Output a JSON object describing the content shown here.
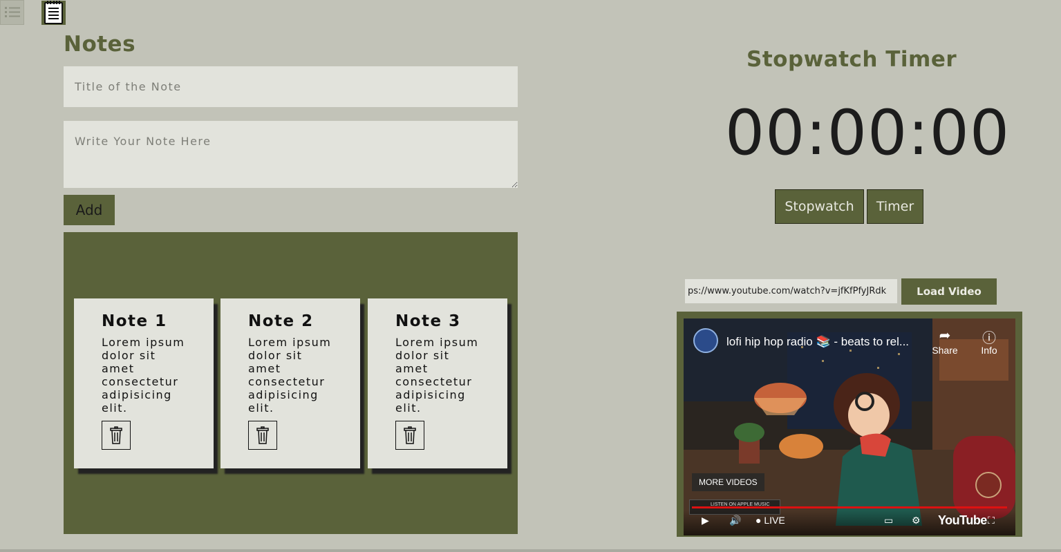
{
  "toolbar": {
    "todo_icon": "checklist-icon",
    "notes_icon": "notepad-icon"
  },
  "notes": {
    "heading": "Notes",
    "title_placeholder": "Title of the Note",
    "body_placeholder": "Write Your Note Here",
    "add_label": "Add",
    "cards": [
      {
        "title": "Note 1",
        "body": "Lorem ipsum dolor sit amet consectetur adipisicing elit."
      },
      {
        "title": "Note 2",
        "body": "Lorem ipsum dolor sit amet consectetur adipisicing elit."
      },
      {
        "title": "Note 3",
        "body": "Lorem ipsum dolor sit amet consectetur adipisicing elit."
      }
    ]
  },
  "stopwatch": {
    "heading": "Stopwatch Timer",
    "display": "00:00:00",
    "stopwatch_label": "Stopwatch",
    "timer_label": "Timer"
  },
  "video": {
    "url_value": "ps://www.youtube.com/watch?v=jfKfPfyJRdk",
    "load_label": "Load Video",
    "title": "lofi hip hop radio 📚 - beats to rel...",
    "share_label": "Share",
    "info_label": "Info",
    "more_videos_label": "MORE VIDEOS",
    "apple_badge": "LISTEN ON APPLE MUSIC",
    "live_label": "LIVE",
    "brand": "YouTube"
  },
  "colors": {
    "background": "#c2c3b8",
    "accent": "#5a623a",
    "card": "#e2e3dc"
  }
}
